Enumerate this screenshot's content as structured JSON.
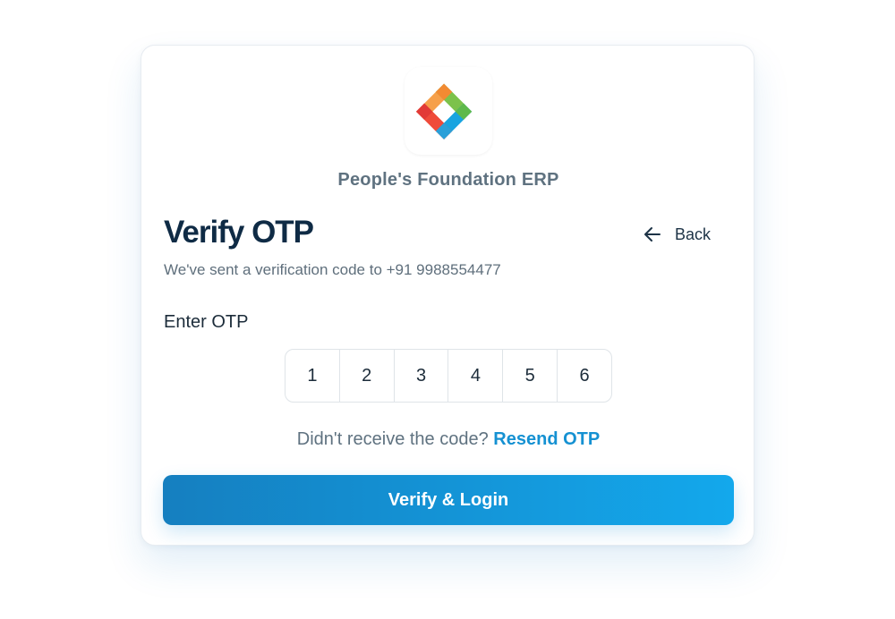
{
  "app": {
    "name": "People's Foundation ERP",
    "logo_icon": "colorful-interlocking-squares-logo"
  },
  "header": {
    "title": "Verify OTP",
    "back_label": "Back",
    "back_icon": "arrow-left-icon"
  },
  "message": {
    "subtitle": "We've sent a verification code to +91 9988554477"
  },
  "otp": {
    "label": "Enter OTP",
    "digits": [
      "1",
      "2",
      "3",
      "4",
      "5",
      "6"
    ]
  },
  "resend": {
    "prompt": "Didn't receive the code?",
    "link_label": "Resend OTP"
  },
  "actions": {
    "verify_label": "Verify & Login"
  },
  "colors": {
    "primary": "#1591d2",
    "button_gradient_start": "#157fc0",
    "button_gradient_end": "#13a8ec",
    "title": "#0f2b45",
    "muted_text": "#5f7280"
  }
}
